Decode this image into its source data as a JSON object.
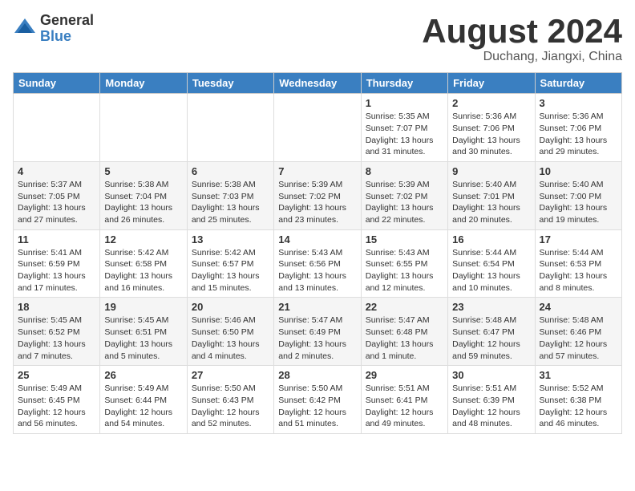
{
  "header": {
    "logo_general": "General",
    "logo_blue": "Blue",
    "month_title": "August 2024",
    "location": "Duchang, Jiangxi, China"
  },
  "weekdays": [
    "Sunday",
    "Monday",
    "Tuesday",
    "Wednesday",
    "Thursday",
    "Friday",
    "Saturday"
  ],
  "weeks": [
    [
      {
        "day": "",
        "info": ""
      },
      {
        "day": "",
        "info": ""
      },
      {
        "day": "",
        "info": ""
      },
      {
        "day": "",
        "info": ""
      },
      {
        "day": "1",
        "info": "Sunrise: 5:35 AM\nSunset: 7:07 PM\nDaylight: 13 hours\nand 31 minutes."
      },
      {
        "day": "2",
        "info": "Sunrise: 5:36 AM\nSunset: 7:06 PM\nDaylight: 13 hours\nand 30 minutes."
      },
      {
        "day": "3",
        "info": "Sunrise: 5:36 AM\nSunset: 7:06 PM\nDaylight: 13 hours\nand 29 minutes."
      }
    ],
    [
      {
        "day": "4",
        "info": "Sunrise: 5:37 AM\nSunset: 7:05 PM\nDaylight: 13 hours\nand 27 minutes."
      },
      {
        "day": "5",
        "info": "Sunrise: 5:38 AM\nSunset: 7:04 PM\nDaylight: 13 hours\nand 26 minutes."
      },
      {
        "day": "6",
        "info": "Sunrise: 5:38 AM\nSunset: 7:03 PM\nDaylight: 13 hours\nand 25 minutes."
      },
      {
        "day": "7",
        "info": "Sunrise: 5:39 AM\nSunset: 7:02 PM\nDaylight: 13 hours\nand 23 minutes."
      },
      {
        "day": "8",
        "info": "Sunrise: 5:39 AM\nSunset: 7:02 PM\nDaylight: 13 hours\nand 22 minutes."
      },
      {
        "day": "9",
        "info": "Sunrise: 5:40 AM\nSunset: 7:01 PM\nDaylight: 13 hours\nand 20 minutes."
      },
      {
        "day": "10",
        "info": "Sunrise: 5:40 AM\nSunset: 7:00 PM\nDaylight: 13 hours\nand 19 minutes."
      }
    ],
    [
      {
        "day": "11",
        "info": "Sunrise: 5:41 AM\nSunset: 6:59 PM\nDaylight: 13 hours\nand 17 minutes."
      },
      {
        "day": "12",
        "info": "Sunrise: 5:42 AM\nSunset: 6:58 PM\nDaylight: 13 hours\nand 16 minutes."
      },
      {
        "day": "13",
        "info": "Sunrise: 5:42 AM\nSunset: 6:57 PM\nDaylight: 13 hours\nand 15 minutes."
      },
      {
        "day": "14",
        "info": "Sunrise: 5:43 AM\nSunset: 6:56 PM\nDaylight: 13 hours\nand 13 minutes."
      },
      {
        "day": "15",
        "info": "Sunrise: 5:43 AM\nSunset: 6:55 PM\nDaylight: 13 hours\nand 12 minutes."
      },
      {
        "day": "16",
        "info": "Sunrise: 5:44 AM\nSunset: 6:54 PM\nDaylight: 13 hours\nand 10 minutes."
      },
      {
        "day": "17",
        "info": "Sunrise: 5:44 AM\nSunset: 6:53 PM\nDaylight: 13 hours\nand 8 minutes."
      }
    ],
    [
      {
        "day": "18",
        "info": "Sunrise: 5:45 AM\nSunset: 6:52 PM\nDaylight: 13 hours\nand 7 minutes."
      },
      {
        "day": "19",
        "info": "Sunrise: 5:45 AM\nSunset: 6:51 PM\nDaylight: 13 hours\nand 5 minutes."
      },
      {
        "day": "20",
        "info": "Sunrise: 5:46 AM\nSunset: 6:50 PM\nDaylight: 13 hours\nand 4 minutes."
      },
      {
        "day": "21",
        "info": "Sunrise: 5:47 AM\nSunset: 6:49 PM\nDaylight: 13 hours\nand 2 minutes."
      },
      {
        "day": "22",
        "info": "Sunrise: 5:47 AM\nSunset: 6:48 PM\nDaylight: 13 hours\nand 1 minute."
      },
      {
        "day": "23",
        "info": "Sunrise: 5:48 AM\nSunset: 6:47 PM\nDaylight: 12 hours\nand 59 minutes."
      },
      {
        "day": "24",
        "info": "Sunrise: 5:48 AM\nSunset: 6:46 PM\nDaylight: 12 hours\nand 57 minutes."
      }
    ],
    [
      {
        "day": "25",
        "info": "Sunrise: 5:49 AM\nSunset: 6:45 PM\nDaylight: 12 hours\nand 56 minutes."
      },
      {
        "day": "26",
        "info": "Sunrise: 5:49 AM\nSunset: 6:44 PM\nDaylight: 12 hours\nand 54 minutes."
      },
      {
        "day": "27",
        "info": "Sunrise: 5:50 AM\nSunset: 6:43 PM\nDaylight: 12 hours\nand 52 minutes."
      },
      {
        "day": "28",
        "info": "Sunrise: 5:50 AM\nSunset: 6:42 PM\nDaylight: 12 hours\nand 51 minutes."
      },
      {
        "day": "29",
        "info": "Sunrise: 5:51 AM\nSunset: 6:41 PM\nDaylight: 12 hours\nand 49 minutes."
      },
      {
        "day": "30",
        "info": "Sunrise: 5:51 AM\nSunset: 6:39 PM\nDaylight: 12 hours\nand 48 minutes."
      },
      {
        "day": "31",
        "info": "Sunrise: 5:52 AM\nSunset: 6:38 PM\nDaylight: 12 hours\nand 46 minutes."
      }
    ]
  ]
}
